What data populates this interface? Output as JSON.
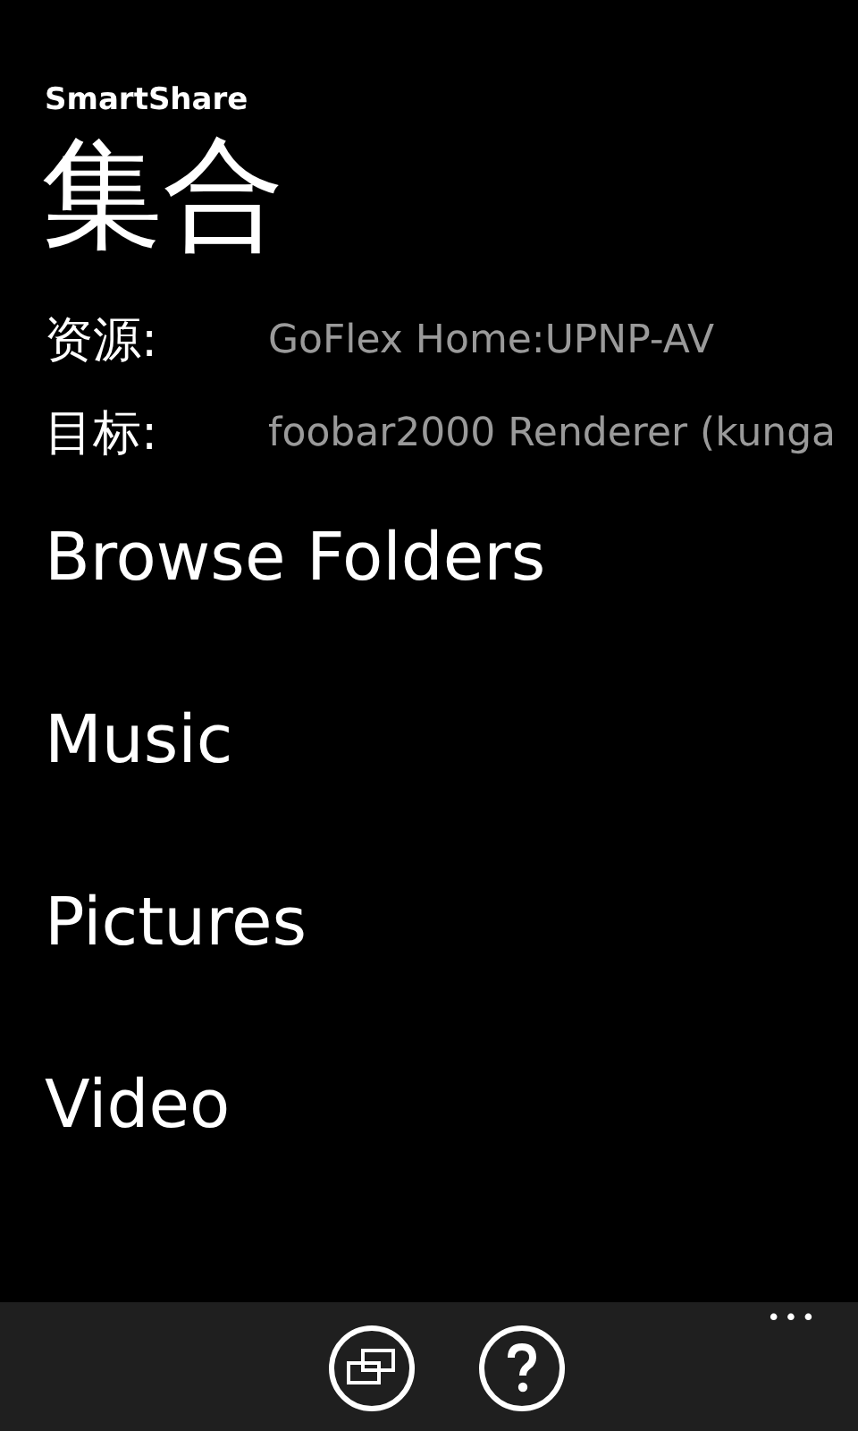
{
  "app_title": "SmartShare",
  "page_title": "集合",
  "info": [
    {
      "label": "资源:",
      "value": "GoFlex Home:UPNP-AV"
    },
    {
      "label": "目标:",
      "value": "foobar2000 Renderer (kunga"
    }
  ],
  "menu": [
    {
      "label": "Browse Folders"
    },
    {
      "label": "Music"
    },
    {
      "label": "Pictures"
    },
    {
      "label": "Video"
    }
  ],
  "app_bar": {
    "buttons": [
      {
        "kind": "switch"
      },
      {
        "kind": "help"
      }
    ],
    "more": "•••"
  }
}
